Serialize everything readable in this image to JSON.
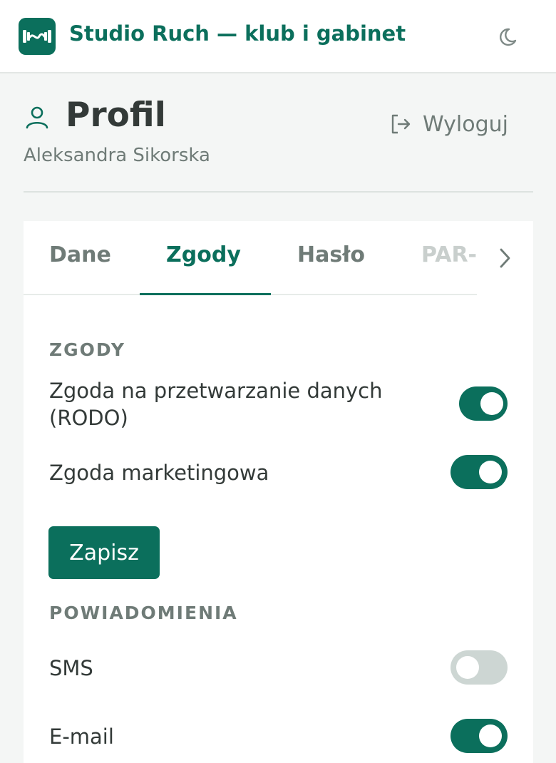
{
  "header": {
    "app_title": "Studio Ruch — klub i gabinet",
    "logo_icon": "dumbbell-icon",
    "theme_icon": "moon-icon"
  },
  "profile": {
    "title": "Profil",
    "user_name": "Aleksandra Sikorska",
    "logout_label": "Wyloguj",
    "icon": "user-icon",
    "logout_icon": "logout-icon"
  },
  "tabs": [
    {
      "label": "Dane",
      "active": false
    },
    {
      "label": "Zgody",
      "active": true
    },
    {
      "label": "Hasło",
      "active": false
    },
    {
      "label": "PAR-Q",
      "active": false
    }
  ],
  "consents": {
    "section_title": "ZGODY",
    "items": [
      {
        "label_line1": "Zgoda na przetwarzanie danych",
        "label_line2": "(RODO)",
        "enabled": true
      },
      {
        "label_line1": "Zgoda marketingowa",
        "enabled": true
      }
    ],
    "save_label": "Zapisz"
  },
  "notifications": {
    "section_title": "POWIADOMIENIA",
    "items": [
      {
        "label": "SMS",
        "enabled": false
      },
      {
        "label": "E-mail",
        "enabled": true
      }
    ]
  },
  "colors": {
    "accent": "#0b6f5c",
    "toggle_off": "#cdd6d3",
    "muted_text": "#6f7b77",
    "background": "#f4f6f5"
  }
}
